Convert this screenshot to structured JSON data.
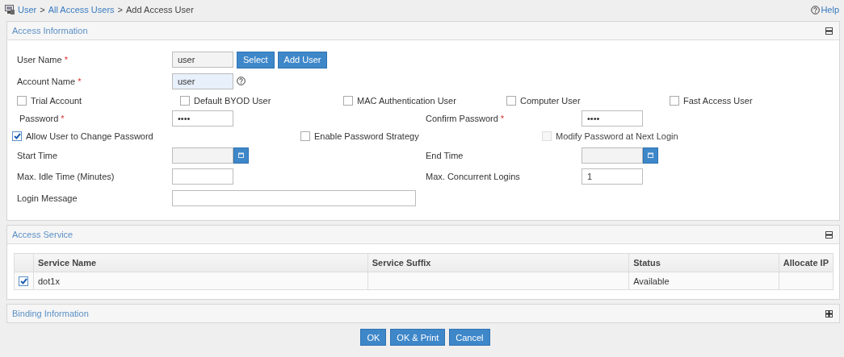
{
  "breadcrumb": [
    {
      "text": "User",
      "link": true
    },
    {
      "text": ">",
      "link": false
    },
    {
      "text": "All Access Users",
      "link": true
    },
    {
      "text": ">",
      "link": false
    },
    {
      "text": "Add Access User",
      "link": false
    }
  ],
  "help": "Help",
  "access_information": {
    "title": "Access Information",
    "expanded": true,
    "user_name": {
      "label": "User Name",
      "required": "*",
      "value": "user",
      "buttons": [
        "Select",
        "Add User"
      ]
    },
    "account_name": {
      "label": "Account Name",
      "required": "*",
      "value": "user"
    },
    "user_types": [
      {
        "label": "Trial Account",
        "checked": false
      },
      {
        "label": "Default BYOD User",
        "checked": false
      },
      {
        "label": "MAC Authentication User",
        "checked": false
      },
      {
        "label": "Computer User",
        "checked": false
      },
      {
        "label": "Fast Access User",
        "checked": false
      }
    ],
    "password": {
      "label": "Password",
      "required": "*",
      "value": "••••"
    },
    "confirm_password": {
      "label": "Confirm Password",
      "required": "*",
      "value": "••••"
    },
    "password_options": [
      {
        "label": "Allow User to Change Password",
        "checked": true,
        "disabled": false
      },
      {
        "label": "Enable Password Strategy",
        "checked": false,
        "disabled": false
      },
      {
        "label": "Modify Password at Next Login",
        "checked": false,
        "disabled": true
      }
    ],
    "start_time": {
      "label": "Start Time"
    },
    "end_time": {
      "label": "End Time"
    },
    "max_idle_time": {
      "label": "Max. Idle Time (Minutes)"
    },
    "max_concurrent_logins": {
      "label": "Max. Concurrent Logins",
      "value": "1"
    },
    "login_message": {
      "label": "Login Message"
    }
  },
  "access_service": {
    "title": "Access Service",
    "expanded": true,
    "table": {
      "columns": [
        "Service Name",
        "Service Suffix",
        "Status",
        "Allocate IP"
      ],
      "rows": [
        {
          "selected": true,
          "service_name": "dot1x",
          "status": "Available"
        }
      ]
    }
  },
  "binding_information": {
    "title": "Binding Information",
    "expanded": false
  },
  "buttons": [
    "OK",
    "OK & Print",
    "Cancel"
  ]
}
